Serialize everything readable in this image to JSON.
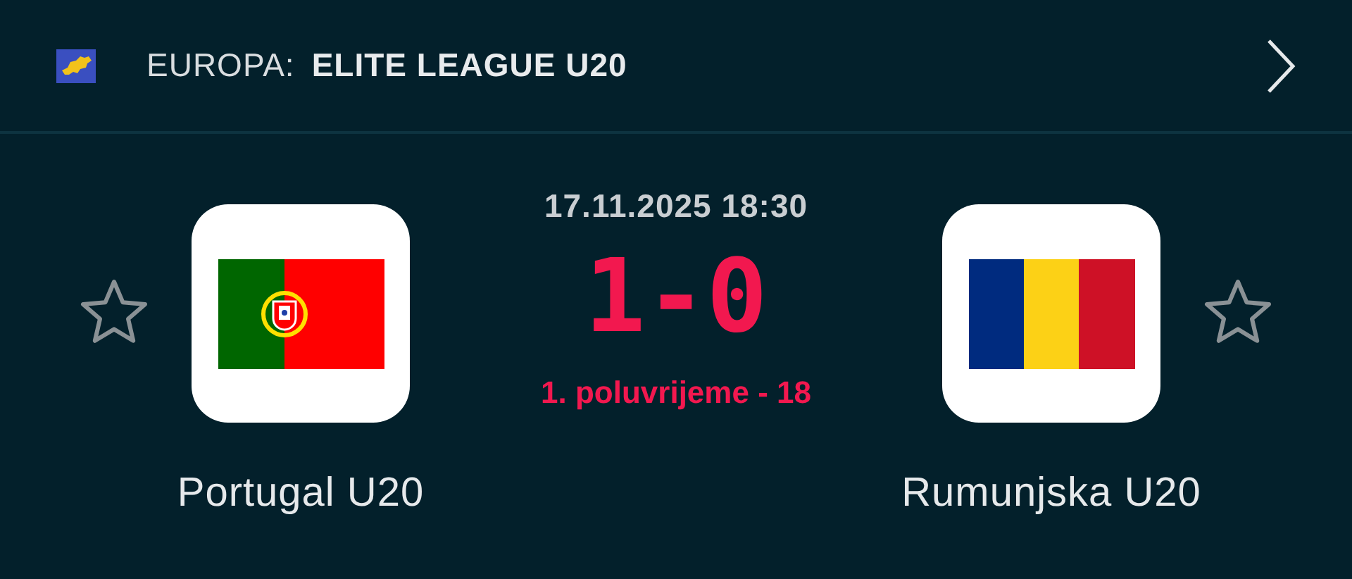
{
  "header": {
    "region": "EUROPA:",
    "competition": "ELITE LEAGUE U20"
  },
  "match": {
    "datetime": "17.11.2025 18:30",
    "score": "1-0",
    "status": "1. poluvrijeme - 18"
  },
  "teams": [
    {
      "name": "Portugal U20",
      "kind": "portugal",
      "favorite": false
    },
    {
      "name": "Rumunjska U20",
      "kind": "romania",
      "favorite": false
    }
  ]
}
